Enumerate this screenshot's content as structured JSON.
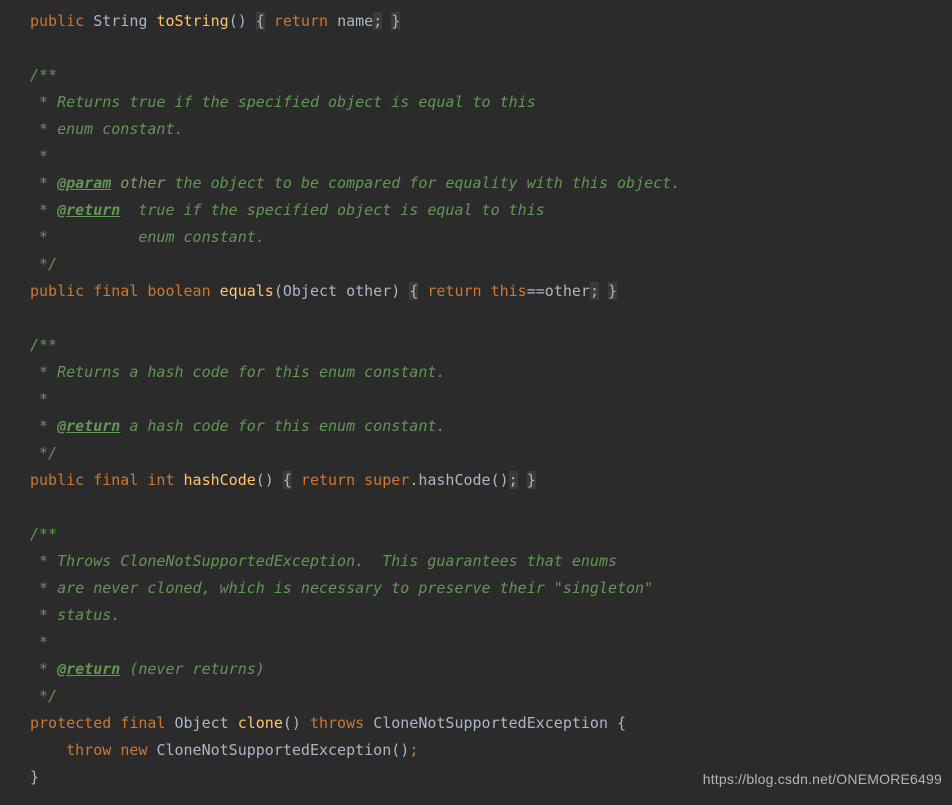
{
  "code": {
    "l1": {
      "kw_public": "public",
      "type_string": "String",
      "method": "toString",
      "p": "()",
      "ob": "{",
      "kw_return": "return",
      "ident": "name",
      "semi": ";",
      "cb": "}"
    },
    "l3": "/**",
    "l4": " * Returns true if the specified object is equal to this",
    "l5": " * enum constant.",
    "l6": " *",
    "l7": {
      "lead": " * ",
      "tag": "@param",
      "param": " other",
      "rest": " the object to be compared for equality with this object."
    },
    "l8": {
      "lead": " * ",
      "tag": "@return",
      "rest": "  true if the specified object is equal to this"
    },
    "l9": " *          enum constant.",
    "l10": " */",
    "l11": {
      "kw_public": "public",
      "kw_final": "final",
      "kw_boolean": "boolean",
      "method": "equals",
      "args": "(Object other)",
      "ob": "{",
      "kw_return": "return",
      "kw_this": "this",
      "op": "==",
      "ident": "other",
      "semi": ";",
      "cb": "}"
    },
    "l13": "/**",
    "l14": " * Returns a hash code for this enum constant.",
    "l15": " *",
    "l16": {
      "lead": " * ",
      "tag": "@return",
      "rest": " a hash code for this enum constant."
    },
    "l17": " */",
    "l18": {
      "kw_public": "public",
      "kw_final": "final",
      "kw_int": "int",
      "method": "hashCode",
      "p": "()",
      "ob": "{",
      "kw_return": "return",
      "kw_super": "super",
      "dot": ".",
      "call": "hashCode()",
      "semi": ";",
      "cb": "}"
    },
    "l20": "/**",
    "l21": " * Throws CloneNotSupportedException.  This guarantees that enums",
    "l22": " * are never cloned, which is necessary to preserve their \"singleton\"",
    "l23": " * status.",
    "l24": " *",
    "l25": {
      "lead": " * ",
      "tag": "@return",
      "rest": " (never returns)"
    },
    "l26": " */",
    "l27": {
      "kw_protected": "protected",
      "kw_final": "final",
      "type_obj": "Object",
      "method": "clone",
      "p": "()",
      "kw_throws": "throws",
      "exc": "CloneNotSupportedException",
      "ob": "{"
    },
    "l28": {
      "indent": "    ",
      "kw_throw": "throw",
      "kw_new": "new",
      "ctor": "CloneNotSupportedException()",
      "semi": ";"
    },
    "l29": "}"
  },
  "watermark": "https://blog.csdn.net/ONEMORE6499"
}
